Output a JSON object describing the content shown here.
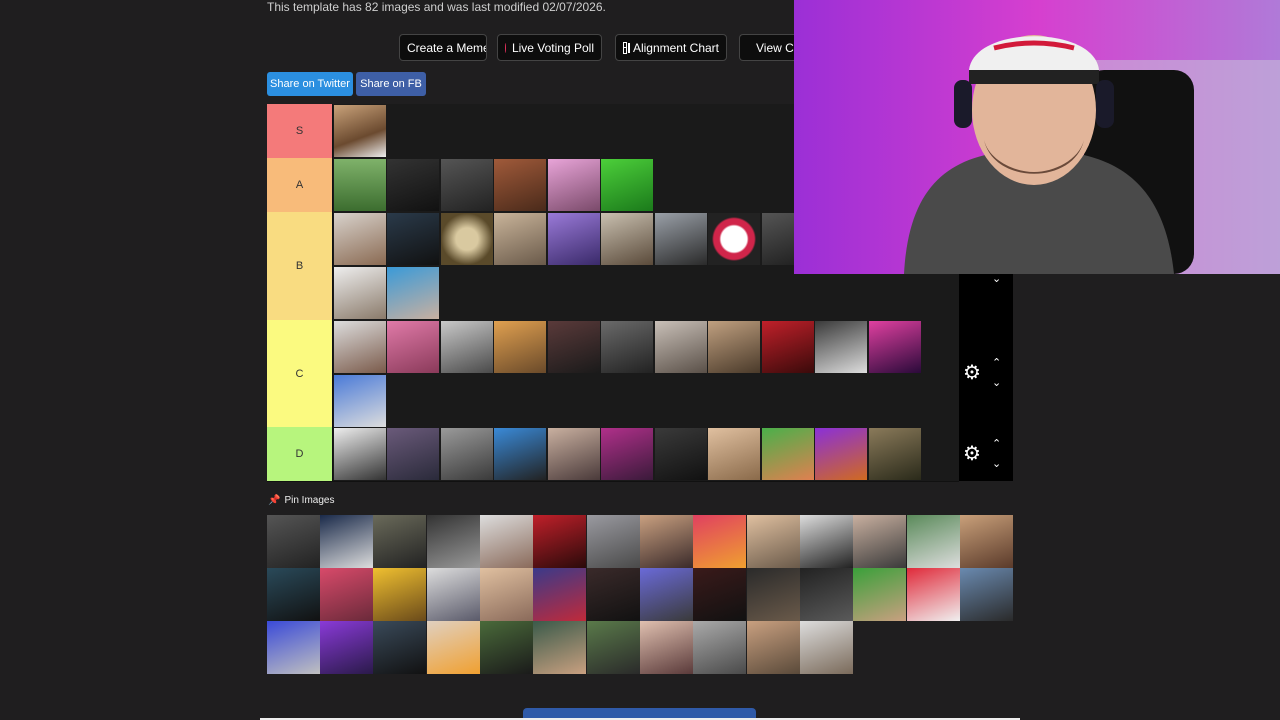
{
  "info_text": "This template has 82 images and was last modified 02/07/2026.",
  "top_buttons": {
    "create_meme": "Create a Meme",
    "live_voting": "Live Voting Poll",
    "alignment": "Alignment Chart",
    "view": "View C"
  },
  "share": {
    "twitter": "Share on Twitter",
    "facebook": "Share on FB"
  },
  "tiers": [
    {
      "label": "S",
      "color": "#f47a7a"
    },
    {
      "label": "A",
      "color": "#f8bb7a"
    },
    {
      "label": "B",
      "color": "#f9dc81"
    },
    {
      "label": "C",
      "color": "#fbfa80"
    },
    {
      "label": "D",
      "color": "#b7f57d"
    }
  ],
  "pin_label": "Pin Images",
  "colors": {
    "twitter": "#1da1f2",
    "facebook": "#3b5998",
    "background": "#1f1e1f"
  }
}
